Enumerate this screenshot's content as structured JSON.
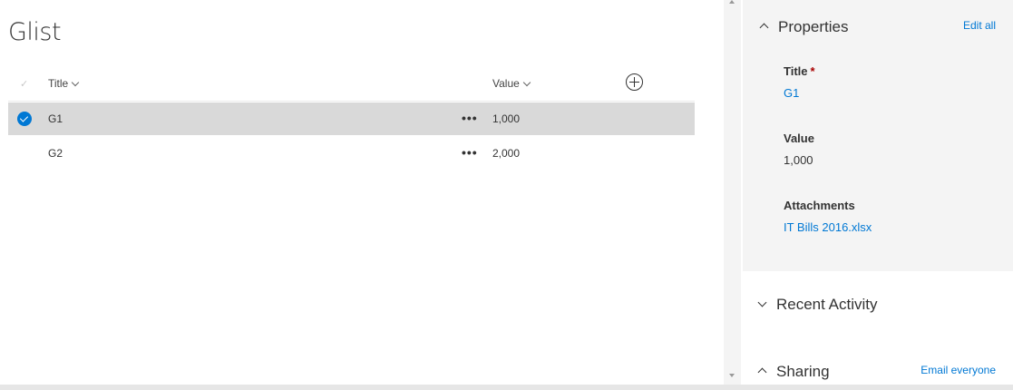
{
  "list": {
    "title": "Glist",
    "columns": {
      "title": "Title",
      "value": "Value"
    },
    "rows": [
      {
        "title": "G1",
        "value": "1,000",
        "selected": true
      },
      {
        "title": "G2",
        "value": "2,000",
        "selected": false
      }
    ],
    "more_glyph": "•••",
    "check_glyph": "✓"
  },
  "details": {
    "properties_label": "Properties",
    "edit_all_label": "Edit all",
    "fields": [
      {
        "label": "Title",
        "required": "*",
        "value": "G1"
      },
      {
        "label": "Value",
        "value": "1,000"
      },
      {
        "label": "Attachments",
        "value": "IT Bills 2016.xlsx"
      }
    ],
    "recent_activity_label": "Recent Activity",
    "sharing_label": "Sharing",
    "email_everyone_label": "Email everyone"
  },
  "colors": {
    "accent": "#0078d4",
    "selected_row": "#d9d9d9",
    "panel_bg": "#f4f4f4",
    "required": "#a80000"
  }
}
